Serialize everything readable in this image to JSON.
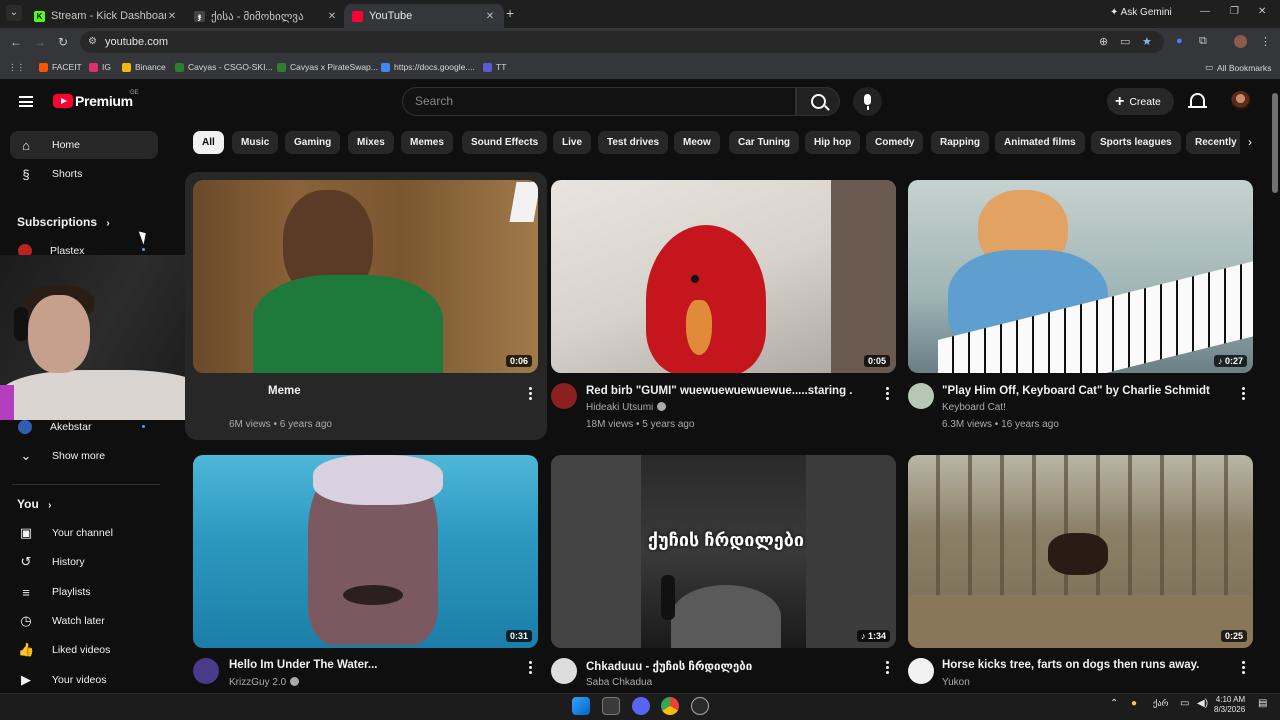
{
  "browser": {
    "tabs": [
      {
        "label": "Stream - Kick Dashboard",
        "fav_letter": "K",
        "fav_color": "#53fc18"
      },
      {
        "label": "ქისა - მიმოხილვა",
        "fav_letter": "ჯ",
        "fav_color": "#444444"
      },
      {
        "label": "YouTube",
        "fav_letter": "",
        "fav_color": "#ff0033"
      }
    ],
    "ask_gemini": "Ask Gemini",
    "url": "youtube.com",
    "bookmarks": [
      {
        "label": "FACEIT",
        "color": "#ff5500"
      },
      {
        "label": "IG",
        "color": "#e1306c"
      },
      {
        "label": "Binance",
        "color": "#f0b90b"
      },
      {
        "label": "Cavyas - CSGO-SKI...",
        "color": "#2e7d32"
      },
      {
        "label": "Cavyas x PirateSwap...",
        "color": "#2e7d32"
      },
      {
        "label": "https://docs.google....",
        "color": "#4285f4"
      },
      {
        "label": "TT",
        "color": "#5b5bd6"
      }
    ],
    "all_bookmarks": "All Bookmarks"
  },
  "yt": {
    "logo": "Premium",
    "country": "GE",
    "search_placeholder": "Search",
    "create": "Create",
    "brand_color": "#ff0033"
  },
  "sidebar": {
    "home": "Home",
    "shorts": "Shorts",
    "subscriptions": "Subscriptions",
    "subs": [
      {
        "label": "Plastex"
      },
      {
        "label": "Akebstar"
      }
    ],
    "show_more": "Show more",
    "you": "You",
    "you_items": [
      {
        "label": "Your channel",
        "icon": "person-box-icon"
      },
      {
        "label": "History",
        "icon": "history-icon"
      },
      {
        "label": "Playlists",
        "icon": "playlists-icon"
      },
      {
        "label": "Watch later",
        "icon": "clock-icon"
      },
      {
        "label": "Liked videos",
        "icon": "thumbs-up-icon"
      },
      {
        "label": "Your videos",
        "icon": "video-icon"
      }
    ]
  },
  "chips": [
    "All",
    "Music",
    "Gaming",
    "Mixes",
    "Memes",
    "Sound Effects",
    "Live",
    "Test drives",
    "Meow",
    "Car Tuning",
    "Hip hop",
    "Comedy",
    "Rapping",
    "Animated films",
    "Sports leagues",
    "Recently"
  ],
  "videos": [
    {
      "title": "Meme",
      "channel": "",
      "meta": "6M views • 6 years ago",
      "duration": "0:06",
      "verified": false
    },
    {
      "title": "Red birb \"GUMI\" wuewuewuewuewue.....staring .",
      "channel": "Hideaki Utsumi",
      "meta": "18M views • 5 years ago",
      "duration": "0:05",
      "verified": true
    },
    {
      "title": "\"Play Him Off, Keyboard Cat\" by Charlie Schmidt",
      "channel": "Keyboard Cat!",
      "meta": "6.3M views • 16 years ago",
      "duration": "0:27",
      "verified": false
    },
    {
      "title": "Hello Im Under The Water...",
      "channel": "KrizzGuy 2.0",
      "meta": "",
      "duration": "0:31",
      "verified": true
    },
    {
      "title": "Chkaduuu - ქუჩის ჩრდილები",
      "channel": "Saba Chkadua",
      "meta": "",
      "duration": "1:34",
      "verified": false,
      "overlay": "ქუჩის ჩრდილები"
    },
    {
      "title": "Horse kicks tree, farts on dogs then runs away.",
      "channel": "Yukon",
      "meta": "",
      "duration": "0:25",
      "verified": false
    }
  ],
  "taskbar": {
    "lang": "ქარ",
    "time": "4:10 AM",
    "date": "8/3/2026"
  }
}
